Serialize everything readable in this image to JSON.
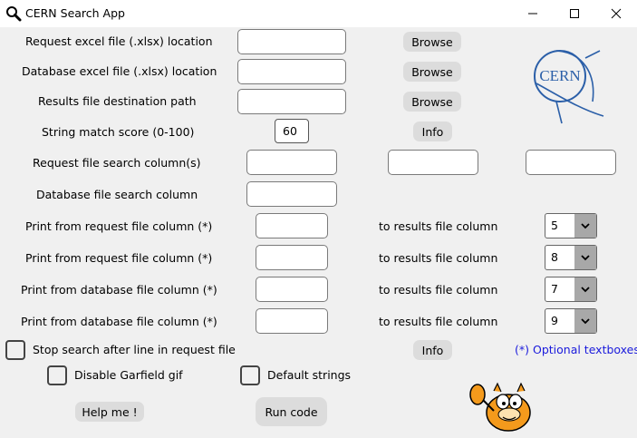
{
  "window": {
    "title": "CERN Search App"
  },
  "labels": {
    "request_file": "Request excel file (.xlsx) location",
    "database_file": "Database excel file (.xlsx) location",
    "results_path": "Results file destination path",
    "match_score": "String match score (0-100)",
    "request_columns": "Request file search column(s)",
    "database_column": "Database file search column",
    "print_req_1": "Print from request file column (*)",
    "print_req_2": "Print from request file column (*)",
    "print_db_1": "Print from database file column (*)",
    "print_db_2": "Print from database file column (*)",
    "to_results_1": "to results file column",
    "to_results_2": "to results file column",
    "to_results_3": "to results file column",
    "to_results_4": "to results file column",
    "optional_note": "(*) Optional textboxes"
  },
  "buttons": {
    "browse_request": "Browse",
    "browse_database": "Browse",
    "browse_results": "Browse",
    "info_score": "Info",
    "info_stop": "Info",
    "help": "Help me !",
    "run": "Run code"
  },
  "inputs": {
    "match_score_value": "60"
  },
  "combos": {
    "results_col_1": "5",
    "results_col_2": "8",
    "results_col_3": "7",
    "results_col_4": "9"
  },
  "checkboxes": {
    "stop_search": "Stop search after line in request file",
    "disable_gif": "Disable Garfield gif",
    "default_strings": "Default strings"
  },
  "logo": {
    "text": "CERN",
    "color": "#2b5fa8"
  }
}
